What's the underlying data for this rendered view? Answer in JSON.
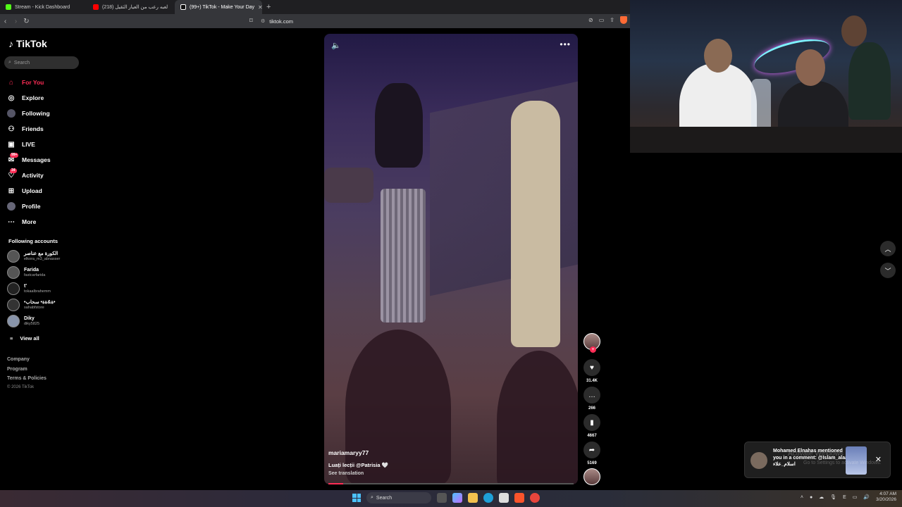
{
  "browser": {
    "tabs": [
      {
        "label": "Stream - Kick Dashboard",
        "color": "#53fc18",
        "active": false
      },
      {
        "label": "لعبه رعب من العيار الثقيل (218)",
        "color": "#ff0000",
        "active": false
      },
      {
        "label": "(99+) TikTok - Make Your Day",
        "color": "#ffffff",
        "active": true
      }
    ],
    "new_tab": "+",
    "url": "tiktok.com"
  },
  "sidebar": {
    "logo": "TikTok",
    "search_placeholder": "Search",
    "nav": [
      {
        "label": "For You",
        "icon": "home-icon",
        "active": true
      },
      {
        "label": "Explore",
        "icon": "compass-icon"
      },
      {
        "label": "Following",
        "icon": "following-icon"
      },
      {
        "label": "Friends",
        "icon": "friends-icon"
      },
      {
        "label": "LIVE",
        "icon": "live-icon"
      },
      {
        "label": "Messages",
        "icon": "messages-icon",
        "badge": "99+"
      },
      {
        "label": "Activity",
        "icon": "activity-icon",
        "badge": "34"
      },
      {
        "label": "Upload",
        "icon": "upload-icon"
      },
      {
        "label": "Profile",
        "icon": "profile-icon"
      },
      {
        "label": "More",
        "icon": "more-icon"
      }
    ],
    "following_header": "Following accounts",
    "accounts": [
      {
        "name": "الكورة مع عناصر",
        "handle": "elkora_m3_abnasser"
      },
      {
        "name": "Farida",
        "handle": "fastcarfarida"
      },
      {
        "name": "t'",
        "handle": "tokaalbrahemm"
      },
      {
        "name": "•ة&ةة• سحاب•",
        "handle": "sahabfstore"
      },
      {
        "name": "Diky",
        "handle": "diky5825"
      }
    ],
    "view_all": "View all",
    "footer": [
      "Company",
      "Program",
      "Terms & Policies"
    ],
    "copyright": "© 2026 TikTok"
  },
  "video": {
    "username": "mariamaryy77",
    "caption": "Luați lecții @Patrisia 🤍",
    "see_translation": "See translation",
    "progress": 0.06
  },
  "actions": {
    "likes": "31.4K",
    "comments": "266",
    "saves": "4667",
    "shares": "5169"
  },
  "notification": {
    "text": "Mohamed Elnahas mentioned you in a comment: @Islam_alaa] اسلام_علاء",
    "watermark": "Activate Windows",
    "watermark2": "Go to Settings to activate Windows."
  },
  "taskbar": {
    "search": "Search",
    "lang": "E",
    "time": "4:07 AM",
    "date": "3/20/2026"
  }
}
